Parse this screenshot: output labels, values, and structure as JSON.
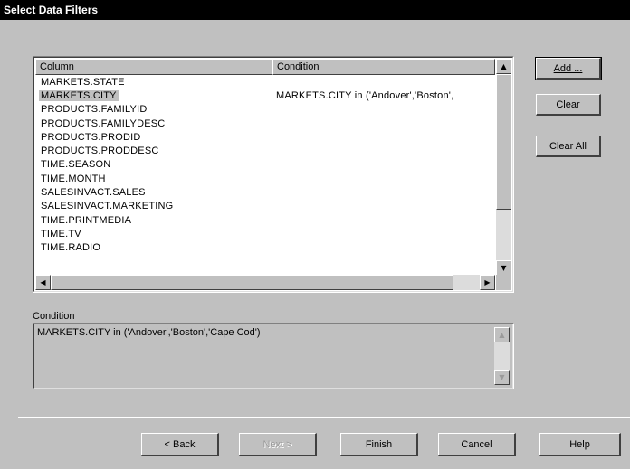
{
  "dialog": {
    "title": "Select Data Filters"
  },
  "list": {
    "columns": [
      "Column",
      "Condition"
    ],
    "rows": [
      {
        "column": "MARKETS.STATE",
        "condition": ""
      },
      {
        "column": "MARKETS.CITY",
        "condition": "MARKETS.CITY in ('Andover','Boston',",
        "selected": true
      },
      {
        "column": "PRODUCTS.FAMILYID",
        "condition": ""
      },
      {
        "column": "PRODUCTS.FAMILYDESC",
        "condition": ""
      },
      {
        "column": "PRODUCTS.PRODID",
        "condition": ""
      },
      {
        "column": "PRODUCTS.PRODDESC",
        "condition": ""
      },
      {
        "column": "TIME.SEASON",
        "condition": ""
      },
      {
        "column": "TIME.MONTH",
        "condition": ""
      },
      {
        "column": "SALESINVACT.SALES",
        "condition": ""
      },
      {
        "column": "SALESINVACT.MARKETING",
        "condition": ""
      },
      {
        "column": "TIME.PRINTMEDIA",
        "condition": ""
      },
      {
        "column": "TIME.TV",
        "condition": ""
      },
      {
        "column": "TIME.RADIO",
        "condition": ""
      }
    ]
  },
  "condition": {
    "label": "Condition",
    "value": "MARKETS.CITY in ('Andover','Boston','Cape Cod')"
  },
  "side_buttons": {
    "add": "Add ...",
    "clear": "Clear",
    "clear_all": "Clear All"
  },
  "footer_buttons": {
    "back": "< Back",
    "next": "Next >",
    "finish": "Finish",
    "cancel": "Cancel",
    "help": "Help"
  }
}
